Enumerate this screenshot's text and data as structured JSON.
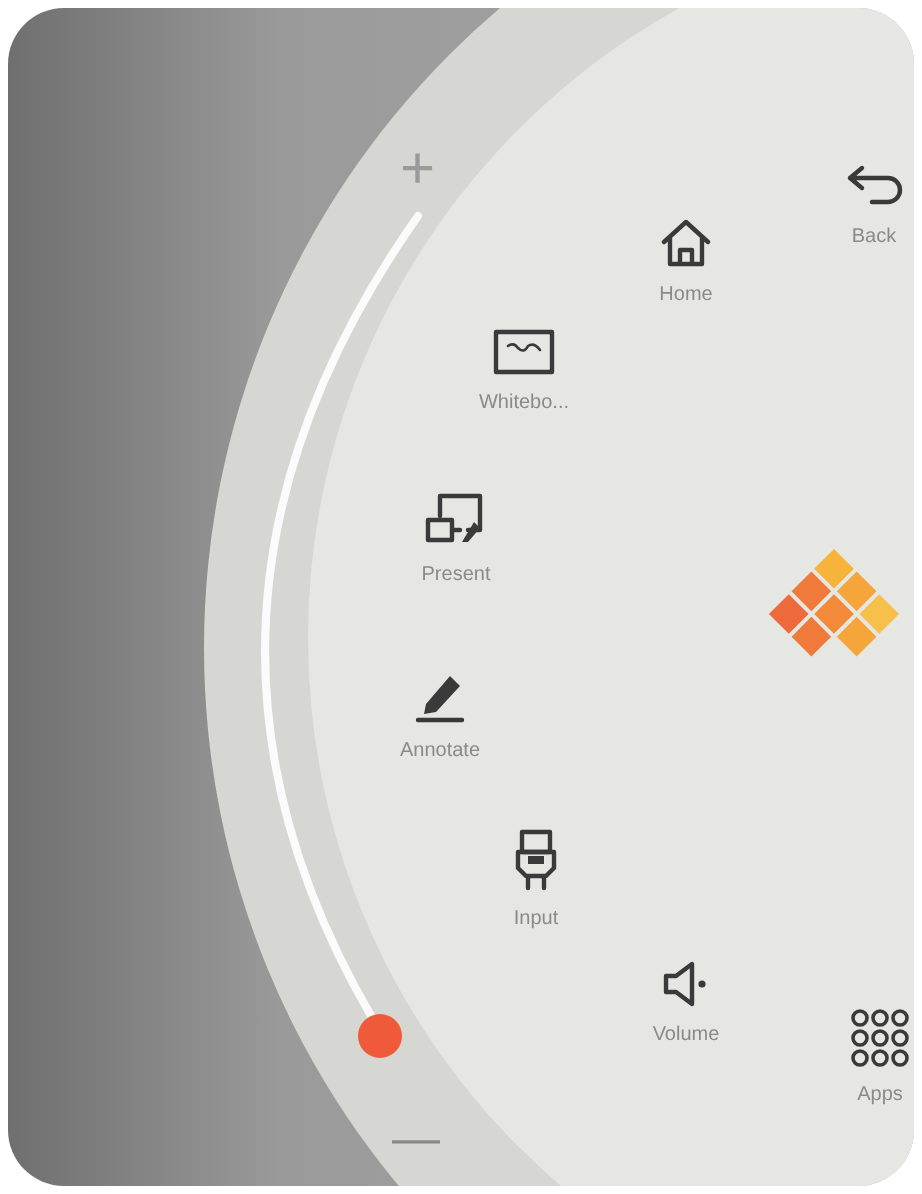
{
  "slider": {
    "plus": "+",
    "minus": "—",
    "level": 0
  },
  "menu_items": [
    {
      "kind": "back",
      "label": "Back"
    },
    {
      "kind": "home",
      "label": "Home"
    },
    {
      "kind": "whiteboard",
      "label": "Whitebo..."
    },
    {
      "kind": "present",
      "label": "Present"
    },
    {
      "kind": "annotate",
      "label": "Annotate"
    },
    {
      "kind": "input",
      "label": "Input"
    },
    {
      "kind": "volume",
      "label": "Volume"
    },
    {
      "kind": "apps",
      "label": "Apps"
    }
  ]
}
